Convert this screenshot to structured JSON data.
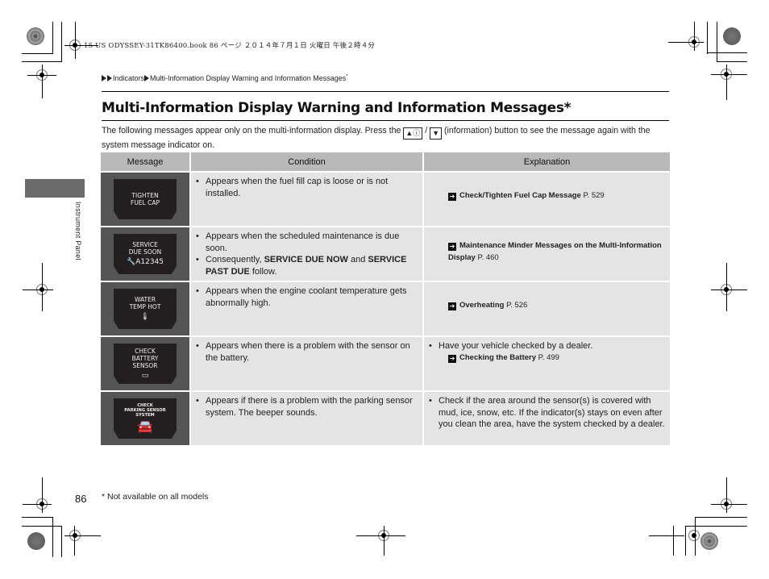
{
  "print_info": "15 US ODYSSEY-31TK86400.book  86 ページ  ２０１４年７月１日  火曜日  午後２時４分",
  "breadcrumb": {
    "items": [
      "Indicators",
      "Multi-Information Display Warning and Information Messages"
    ],
    "suffix": "*"
  },
  "title": "Multi-Information Display Warning and Information Messages",
  "title_suffix": "*",
  "intro": {
    "before": "The following messages appear only on the multi-information display. Press the",
    "button_up": "▲ⓘ",
    "separator": "/",
    "button_down": "▼",
    "after": "(information) button to see the message again with the system message indicator on."
  },
  "side_tab_label": "Instrument Panel",
  "table": {
    "headers": [
      "Message",
      "Condition",
      "Explanation"
    ],
    "rows": [
      {
        "display": [
          "TIGHTEN",
          "FUEL CAP"
        ],
        "display_icon": "",
        "condition": [
          "Appears when the fuel fill cap is loose or is not installed."
        ],
        "explanation_text": "",
        "ref_title": "Check/Tighten Fuel Cap Message",
        "ref_page": "P. 529"
      },
      {
        "display": [
          "SERVICE",
          "DUE SOON"
        ],
        "display_icon": "🔧A12345",
        "condition_1": "Appears when the scheduled maintenance is due soon.",
        "condition_2_pre": "Consequently,",
        "condition_2_b1": "SERVICE DUE NOW",
        "condition_2_mid": "and",
        "condition_2_b2": "SERVICE PAST DUE",
        "condition_2_post": "follow.",
        "ref_title": "Maintenance Minder Messages on the Multi-Information Display",
        "ref_page": "P. 460"
      },
      {
        "display": [
          "WATER",
          "TEMP HOT"
        ],
        "display_icon": "🌡",
        "condition": [
          "Appears when the engine coolant temperature gets abnormally high."
        ],
        "ref_title": "Overheating",
        "ref_page": "P. 526"
      },
      {
        "display": [
          "CHECK",
          "BATTERY",
          "SENSOR"
        ],
        "display_icon": "▭",
        "condition": [
          "Appears when there is a problem with the sensor on the battery."
        ],
        "explanation_text": "Have your vehicle checked by a dealer.",
        "ref_title": "Checking the Battery",
        "ref_page": "P. 499"
      },
      {
        "display": [
          "CHECK",
          "PARKING SENSOR",
          "SYSTEM"
        ],
        "display_icon": "🚘",
        "condition": [
          "Appears if there is a problem with the parking sensor system. The beeper sounds."
        ],
        "explanation_text": "Check if the area around the sensor(s) is covered with mud, ice, snow, etc. If the indicator(s) stays on even after you clean the area, have the system checked by a dealer."
      }
    ]
  },
  "icons": {
    "breadcrumb": "triangle-right-icon",
    "ref": "arrow-right-box-icon"
  },
  "footer": {
    "page_number": "86",
    "footnote": "* Not available on all models"
  }
}
